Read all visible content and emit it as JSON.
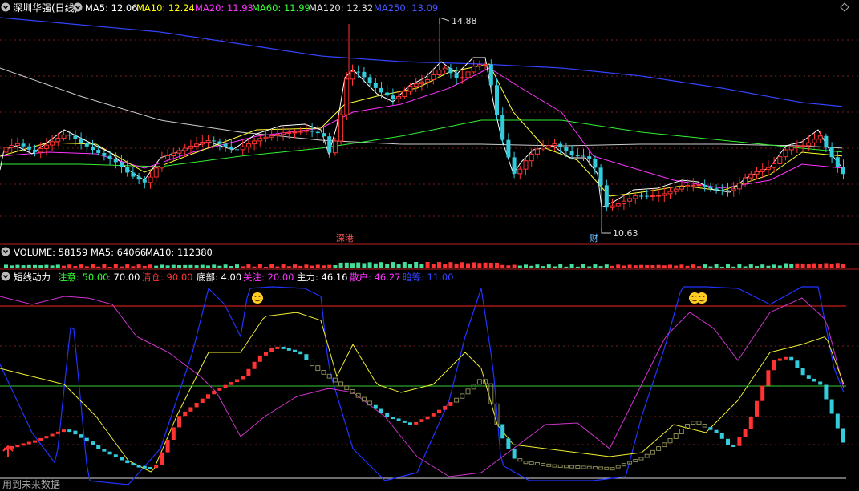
{
  "price_header": {
    "name": "深圳华强(日线)",
    "ma5": {
      "label": "MA5: ",
      "value": "12.06",
      "color": "#ffffff"
    },
    "ma10": {
      "label": "MA10: ",
      "value": "12.24",
      "color": "#ffff00"
    },
    "ma20": {
      "label": "MA20: ",
      "value": "11.93",
      "color": "#ff33ff"
    },
    "ma60": {
      "label": "MA60: ",
      "value": "11.99",
      "color": "#33ff33"
    },
    "ma120": {
      "label": "MA120: ",
      "value": "12.32",
      "color": "#dddddd"
    },
    "ma250": {
      "label": "MA250: ",
      "value": "13.09",
      "color": "#4455ff"
    }
  },
  "price_annotations": {
    "high_label": "14.88",
    "low_label": "10.63",
    "event_badge_1": "深港",
    "event_badge_2": "财"
  },
  "volume_header": {
    "label": "VOLUME: 58159",
    "ma5": "MA5: 64066",
    "ma10": "MA10: 112380"
  },
  "indicator_header": {
    "name": "短线动力",
    "items": [
      {
        "label": "注意: ",
        "value": "50.00",
        "color": "#33ff33"
      },
      {
        "label": "",
        "value": ": 70.00",
        "color": "#ffffff"
      },
      {
        "label": "清仓: ",
        "value": "90.00",
        "color": "#ff3333"
      },
      {
        "label": "底部: ",
        "value": "4.00",
        "color": "#ffffff"
      },
      {
        "label": "关注: ",
        "value": "20.00",
        "color": "#ff33ff"
      },
      {
        "label": "主力: ",
        "value": "46.16",
        "color": "#ffffff"
      },
      {
        "label": "散户: ",
        "value": "46.27",
        "color": "#ff33ff"
      },
      {
        "label": "暗筹: ",
        "value": "11.00",
        "color": "#3344ff"
      }
    ]
  },
  "footer_text": "用到未来数据",
  "colors": {
    "up_candle": "#ff3333",
    "down_candle": "#33ccdd",
    "grid": "#882222",
    "hline_red": "#ff2222",
    "hline_green": "#33cc33"
  },
  "chart_data": {
    "type": "candlestick",
    "price_high": 14.88,
    "price_low": 10.63,
    "current_ma": {
      "ma5": 12.06,
      "ma10": 12.24,
      "ma20": 11.93,
      "ma60": 11.99,
      "ma120": 12.32,
      "ma250": 13.09
    },
    "volume": 58159,
    "volume_ma5": 64066,
    "volume_ma10": 112380,
    "indicator_levels": {
      "注意": 50.0,
      "": 70.0,
      "清仓": 90.0,
      "底部": 4.0,
      "关注": 20.0
    },
    "indicator_values": {
      "主力": 46.16,
      "散户": 46.27,
      "暗筹": 11.0
    }
  }
}
